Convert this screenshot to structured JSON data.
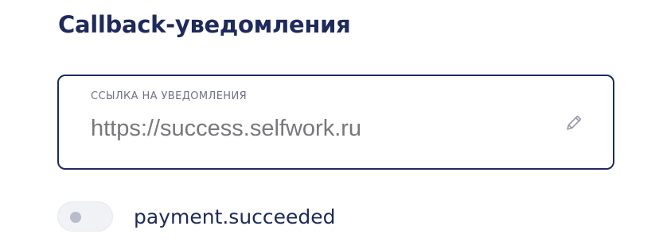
{
  "section": {
    "title": "Callback-уведомления"
  },
  "url_field": {
    "label": "ССЫЛКА НА УВЕДОМЛЕНИЯ",
    "value": "https://success.selfwork.ru",
    "edit_icon": "pencil-icon"
  },
  "event_toggle": {
    "label": "payment.succeeded",
    "enabled": false
  },
  "colors": {
    "title": "#1f2a5c",
    "border": "#1f2a5c",
    "value_text": "#77787c",
    "label_text": "#6e7287",
    "toggle_track": "#f1f2f6",
    "toggle_knob": "#b9bccb"
  }
}
